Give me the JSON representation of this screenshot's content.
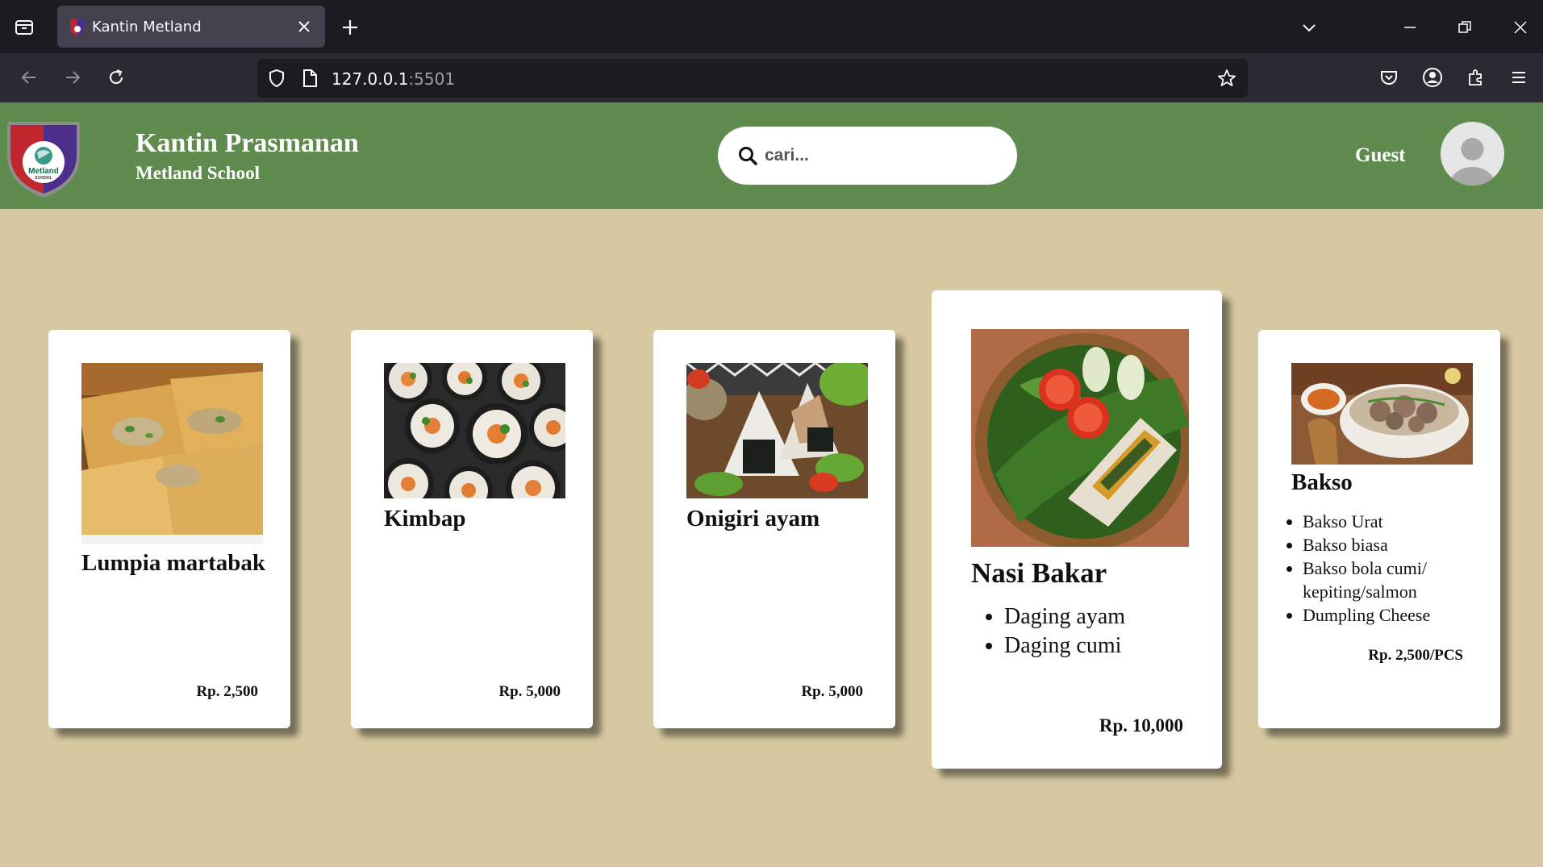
{
  "browser": {
    "tab_title": "Kantin Metland",
    "url_host": "127.0.0.1",
    "url_port": ":5501"
  },
  "header": {
    "title": "Kantin Prasmanan",
    "subtitle": "Metland School",
    "logo_text": "Metland",
    "logo_subtext": "SCHOOL",
    "search_placeholder": "cari...",
    "user_label": "Guest"
  },
  "menu": [
    {
      "name": "Lumpia martabak",
      "price": "Rp. 2,500",
      "items": [],
      "image": "lumpia-photo"
    },
    {
      "name": "Kimbap",
      "price": "Rp. 5,000",
      "items": [],
      "image": "kimbap-photo"
    },
    {
      "name": "Onigiri ayam",
      "price": "Rp. 5,000",
      "items": [],
      "image": "onigiri-photo"
    },
    {
      "name": "Nasi Bakar",
      "price": "Rp. 10,000",
      "items": [
        "Daging ayam",
        "Daging cumi"
      ],
      "image": "nasi-bakar-photo"
    },
    {
      "name": "Bakso",
      "price": "Rp. 2,500/PCS",
      "items": [
        "Bakso Urat",
        "Bakso biasa",
        "Bakso bola cumi/ kepiting/salmon",
        "Dumpling Cheese"
      ],
      "image": "bakso-photo"
    }
  ],
  "colors": {
    "header_green": "#5f8c4e",
    "page_background": "#d6c8a0"
  }
}
